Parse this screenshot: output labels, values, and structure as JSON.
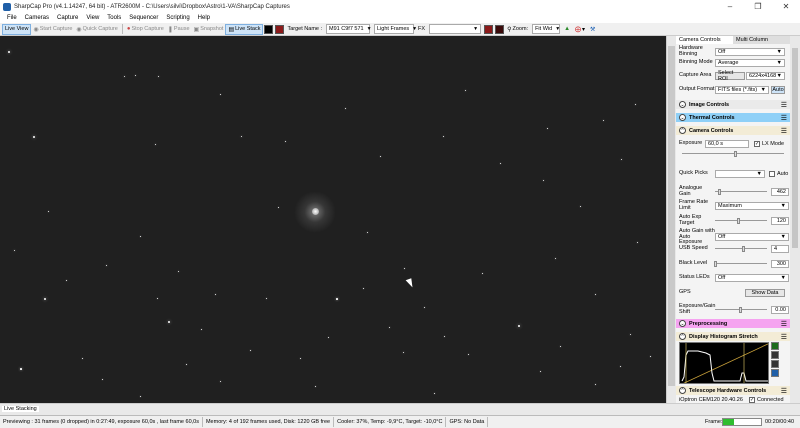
{
  "window": {
    "title": "SharpCap Pro (v4.1.14247, 64 bit) - ATR2600M - C:\\Users\\silvi\\Dropbox\\Astro\\1-VA\\SharpCap Captures"
  },
  "menu": [
    "File",
    "Cameras",
    "Capture",
    "View",
    "Tools",
    "Sequencer",
    "Scripting",
    "Help"
  ],
  "toolbar": {
    "live_view": "Live View",
    "start_capture": "Start Capture",
    "quick_capture": "Quick Capture",
    "stop_capture": "Stop Capture",
    "pause": "Pause",
    "snapshot": "Snapshot",
    "live_stack": "Live Stack",
    "target_label": "Target Name :",
    "target_value": "M91 C9f7 571",
    "frame_type": "Light Frames",
    "fx_label": "FX",
    "fx_value": "",
    "zoom_label": "Zoom:",
    "zoom_value": "Fit Wid",
    "swatch_color_1": "#8b1a1a",
    "swatch_color_2": "#3a0a0a"
  },
  "panel": {
    "tabs": [
      "Camera Controls",
      "Multi Column"
    ],
    "binning": {
      "label": "Hardware Binning",
      "value": "Off"
    },
    "binning_mode": {
      "label": "Binning Mode",
      "value": "Average"
    },
    "capture_area": {
      "label": "Capture Area",
      "button": "Select ROI",
      "value": "6224x4168"
    },
    "output_format": {
      "label": "Output Format",
      "value": "FITS files (*.fits)",
      "button": "Auto"
    },
    "sections": {
      "image_controls": "Image Controls",
      "thermal_controls": "Thermal Controls",
      "camera_controls": "Camera Controls",
      "preprocessing": "Preprocessing",
      "histogram": "Display Histogram Stretch",
      "telescope": "Telescope Hardware Controls"
    },
    "exposure": {
      "label": "Exposure",
      "value": "60,0 s",
      "lx_label": "LX Mode"
    },
    "quick_picks": {
      "label": "Quick Picks",
      "value": "",
      "auto_label": "Auto"
    },
    "analogue_gain": {
      "label": "Analogue Gain",
      "value": "462",
      "level": 0.1
    },
    "frame_rate": {
      "label": "Frame Rate Limit",
      "value": "Maximum"
    },
    "auto_exp_target": {
      "label": "Auto Exp Target",
      "value": "120",
      "level": 0.47
    },
    "auto_gain": {
      "label": "Auto Gain with Auto Exposure",
      "value": "Off"
    },
    "usb_speed": {
      "label": "USB Speed",
      "value": "4",
      "level": 0.55
    },
    "black_level": {
      "label": "Black Level",
      "value": "300",
      "level": 0.02
    },
    "status_leds": {
      "label": "Status LEDs",
      "value": "Off"
    },
    "gps": {
      "label": "GPS",
      "button": "Show Data"
    },
    "exposure_gain_shift": {
      "label": "Exposure/Gain Shift",
      "value": "0.00",
      "level": 0.5
    },
    "telescope_row": "iOptron CEM120 20.40.26",
    "connected_label": "Connected"
  },
  "bottom_tab": "Live Stacking",
  "status": {
    "previewing": "Previewing : 31 frames (0 dropped) in 0:27:49, exposure 60,0s , last frame 60,0s",
    "memory": "Memory: 4 of 192 frames used, Disk: 1220 GB free",
    "cooler": "Cooler: 37%, Temp: -9,9°C, Target: -10,0°C",
    "gps": "GPS: No Data",
    "frame_label": "Frame:",
    "frame_progress": 0.3,
    "frame_time": "00:20/00:40"
  }
}
